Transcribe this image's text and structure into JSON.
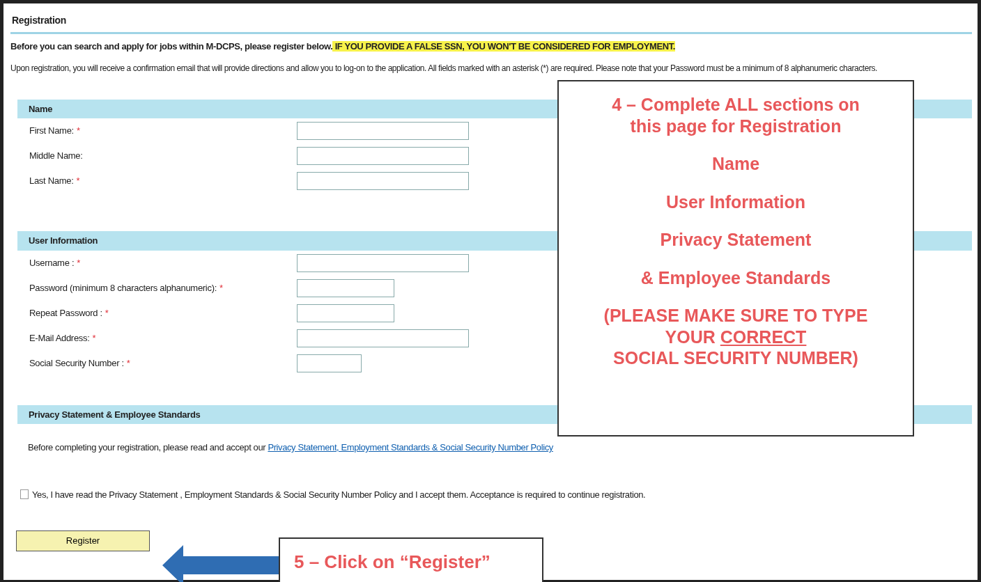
{
  "page": {
    "title": "Registration"
  },
  "intro": {
    "text": "Before you can search and apply for jobs within M-DCPS, please register below.",
    "warning": " IF YOU PROVIDE A FALSE SSN, YOU WON'T BE CONSIDERED FOR EMPLOYMENT."
  },
  "notice": "Upon registration, you will receive a confirmation email that will provide directions and allow you to log-on to the application. All fields marked with an asterisk (*) are required. Please note that your Password must be a minimum of 8 alphanumeric characters.",
  "sections": [
    {
      "title": "Name",
      "fields": [
        {
          "label": "First Name:",
          "marker": "*",
          "kind": "long"
        },
        {
          "label": "Middle Name:",
          "kind": "long"
        },
        {
          "label": "Last Name:",
          "marker": "*",
          "kind": "long"
        }
      ]
    },
    {
      "title": "User Information",
      "fields": [
        {
          "label": "Username :",
          "marker": "*",
          "kind": "long"
        },
        {
          "label": "Password (minimum 8 characters alphanumeric):",
          "marker": "*",
          "kind": "medium"
        },
        {
          "label": "Repeat Password :",
          "marker": "*",
          "kind": "medium"
        },
        {
          "label": "E-Mail Address:",
          "marker": "*",
          "kind": "long"
        },
        {
          "label": "Social Security Number :",
          "marker": "*",
          "kind": "short"
        }
      ]
    }
  ],
  "privacy": {
    "title": "Privacy Statement & Employee Standards",
    "text": "Before completing your registration, please read and accept our",
    "link": "Privacy Statement, Employment Standards & Social Security Number Policy",
    "checkbox": {
      "label": "Yes, I have read the Privacy Statement , Employment Standards & Social Security Number Policy and I accept them. Acceptance is required to continue registration.",
      "checked": false
    }
  },
  "register_button": "Register",
  "callouts": [
    {
      "kind": "box",
      "paragraphs": [
        [
          [
            {
              "text": "4 – Complete ALL sections on",
              "underlined": false
            }
          ],
          [
            {
              "text": "this page for Registration",
              "underlined": false
            }
          ]
        ],
        [
          [
            {
              "text": "Name",
              "underlined": false
            }
          ]
        ],
        [
          [
            {
              "text": "User Information",
              "underlined": false
            }
          ]
        ],
        [
          [
            {
              "text": "Privacy Statement",
              "underlined": false
            }
          ]
        ],
        [
          [
            {
              "text": "& Employee Standards",
              "underlined": false
            }
          ]
        ],
        [
          [
            {
              "text": "(PLEASE MAKE SURE TO TYPE",
              "underlined": false
            }
          ],
          [
            {
              "text": "YOUR ",
              "underlined": false
            },
            {
              "text": "CORRECT",
              "underlined": true
            }
          ],
          [
            {
              "text": "SOCIAL SECURITY NUMBER)",
              "underlined": false
            }
          ]
        ]
      ]
    },
    {
      "kind": "arrow",
      "paragraphs": [
        [
          [
            {
              "text": "5 – Click on “Register”",
              "underlined": false
            }
          ]
        ]
      ]
    }
  ]
}
